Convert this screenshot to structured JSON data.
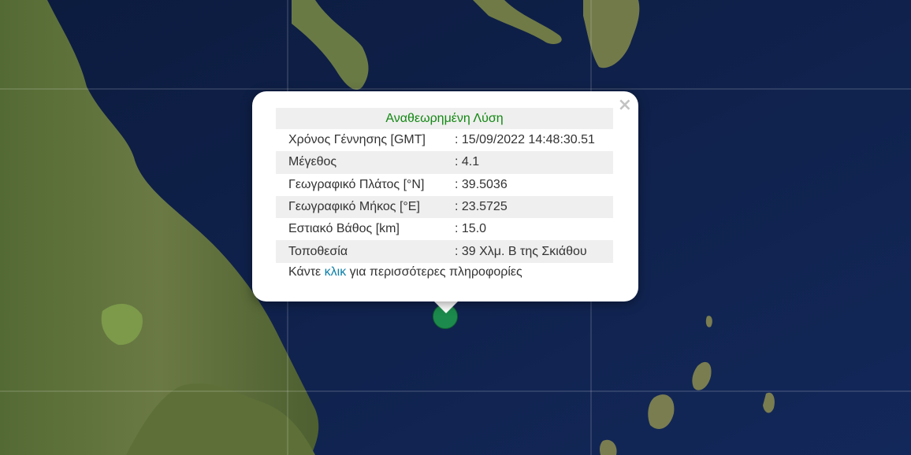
{
  "popup": {
    "close_symbol": "×",
    "title": "Αναθεωρημένη Λύση",
    "rows": [
      {
        "label": "Χρόνος Γέννησης [GMT]",
        "value": ": 15/09/2022 14:48:30.51"
      },
      {
        "label": "Μέγεθος",
        "value": ": 4.1"
      },
      {
        "label": "Γεωγραφικό Πλάτος [°N]",
        "value": ": 39.5036"
      },
      {
        "label": "Γεωγραφικό Μήκος [°E]",
        "value": ": 23.5725"
      },
      {
        "label": "Εστιακό Βάθος [km]",
        "value": ": 15.0"
      },
      {
        "label": "Τοποθεσία",
        "value": ": 39 Χλμ. Β της Σκιάθου"
      }
    ],
    "more_prefix": "Κάντε",
    "more_link": "κλικ",
    "more_suffix": "για περισσότερες πληροφορίες"
  },
  "colors": {
    "title": "#128712",
    "link": "#0b7fa8",
    "marker": "#1c8a4c",
    "sea": "#0f1f44"
  },
  "map": {
    "basemap": "satellite"
  }
}
